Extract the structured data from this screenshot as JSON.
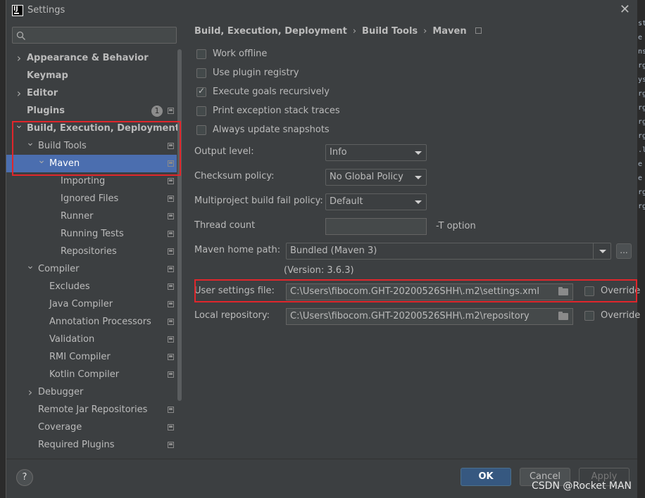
{
  "window": {
    "title": "Settings"
  },
  "search": {
    "placeholder": "",
    "value": ""
  },
  "tree": [
    {
      "label": "Appearance & Behavior",
      "bold": true,
      "arrow": "right"
    },
    {
      "label": "Keymap",
      "bold": true,
      "arrow": ""
    },
    {
      "label": "Editor",
      "bold": true,
      "arrow": "right"
    },
    {
      "label": "Plugins",
      "bold": true,
      "arrow": "",
      "badge": "1",
      "icon": true
    },
    {
      "label": "Build, Execution, Deployment",
      "bold": true,
      "arrow": "down"
    },
    {
      "label": "Build Tools",
      "bold": false,
      "arrow": "down",
      "icon": true
    },
    {
      "label": "Maven",
      "bold": false,
      "arrow": "down",
      "icon": true,
      "selected": true
    },
    {
      "label": "Importing",
      "bold": false,
      "arrow": "",
      "icon": true
    },
    {
      "label": "Ignored Files",
      "bold": false,
      "arrow": "",
      "icon": true
    },
    {
      "label": "Runner",
      "bold": false,
      "arrow": "",
      "icon": true
    },
    {
      "label": "Running Tests",
      "bold": false,
      "arrow": "",
      "icon": true
    },
    {
      "label": "Repositories",
      "bold": false,
      "arrow": "",
      "icon": true
    },
    {
      "label": "Compiler",
      "bold": false,
      "arrow": "down",
      "icon": true
    },
    {
      "label": "Excludes",
      "bold": false,
      "arrow": "",
      "icon": true
    },
    {
      "label": "Java Compiler",
      "bold": false,
      "arrow": "",
      "icon": true
    },
    {
      "label": "Annotation Processors",
      "bold": false,
      "arrow": "",
      "icon": true
    },
    {
      "label": "Validation",
      "bold": false,
      "arrow": "",
      "icon": true
    },
    {
      "label": "RMI Compiler",
      "bold": false,
      "arrow": "",
      "icon": true
    },
    {
      "label": "Kotlin Compiler",
      "bold": false,
      "arrow": "",
      "icon": true
    },
    {
      "label": "Debugger",
      "bold": false,
      "arrow": "right"
    },
    {
      "label": "Remote Jar Repositories",
      "bold": false,
      "arrow": "",
      "icon": true
    },
    {
      "label": "Coverage",
      "bold": false,
      "arrow": "",
      "icon": true
    },
    {
      "label": "Required Plugins",
      "bold": false,
      "arrow": "",
      "icon": true
    }
  ],
  "breadcrumb": {
    "items": [
      "Build, Execution, Deployment",
      "Build Tools",
      "Maven"
    ],
    "separator": "›"
  },
  "checkboxes": [
    {
      "label": "Work offline",
      "checked": false
    },
    {
      "label": "Use plugin registry",
      "checked": false
    },
    {
      "label": "Execute goals recursively",
      "checked": true
    },
    {
      "label": "Print exception stack traces",
      "checked": false
    },
    {
      "label": "Always update snapshots",
      "checked": false
    }
  ],
  "fields": {
    "output_level": {
      "label": "Output level:",
      "value": "Info"
    },
    "checksum_policy": {
      "label": "Checksum policy:",
      "value": "No Global Policy"
    },
    "multiproject_fail_policy": {
      "label": "Multiproject build fail policy:",
      "value": "Default"
    },
    "thread_count": {
      "label": "Thread count",
      "value": "",
      "suffix": "-T option"
    },
    "maven_home": {
      "label": "Maven home path:",
      "value": "Bundled (Maven 3)",
      "button": "...",
      "version": "(Version: 3.6.3)"
    },
    "user_settings": {
      "label": "User settings file:",
      "value": "C:\\Users\\fibocom.GHT-20200526SHH\\.m2\\settings.xml",
      "override_label": "Override",
      "override_checked": false
    },
    "local_repository": {
      "label": "Local repository:",
      "value": "C:\\Users\\fibocom.GHT-20200526SHH\\.m2\\repository",
      "override_label": "Override",
      "override_checked": false
    }
  },
  "buttons": {
    "help": "?",
    "ok": "OK",
    "cancel": "Cancel",
    "apply": "Apply"
  },
  "watermark": "CSDN @Rocket MAN",
  "colors": {
    "selection": "#4b6eaf",
    "highlight_box": "#e0262b",
    "ok_button": "#365880"
  },
  "background_editor_glyphs": [
    "st",
    "e",
    "ns",
    "rg",
    "ys",
    "rg",
    "rg",
    "rg",
    "rg",
    ".l",
    "e",
    "e",
    "rg",
    "rg"
  ]
}
